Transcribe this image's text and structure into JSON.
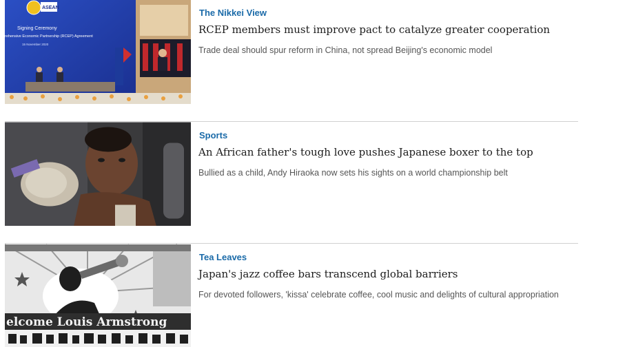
{
  "articles": [
    {
      "section": "The Nikkei View",
      "headline": "RCEP members must improve pact to catalyze greater cooperation",
      "summary": "Trade deal should spur reform in China, not spread Beijing's economic model",
      "image": {
        "logo_text": "ASEAN",
        "title_lines": [
          "Signing Ceremony",
          "rehensive Economic Partnership (RCEP) Agreement",
          "15 November 2020"
        ]
      }
    },
    {
      "section": "Sports",
      "headline": "An African father's tough love pushes Japanese boxer to the top",
      "summary": "Bullied as a child, Andy Hiraoka now sets his sights on a world championship belt"
    },
    {
      "section": "Tea Leaves",
      "headline": "Japan's jazz coffee bars transcend global barriers",
      "summary": "For devoted followers, 'kissa' celebrate coffee, cool music and delights of cultural appropriation",
      "image": {
        "banner_text": "elcome  Louis Armstrong"
      }
    }
  ]
}
